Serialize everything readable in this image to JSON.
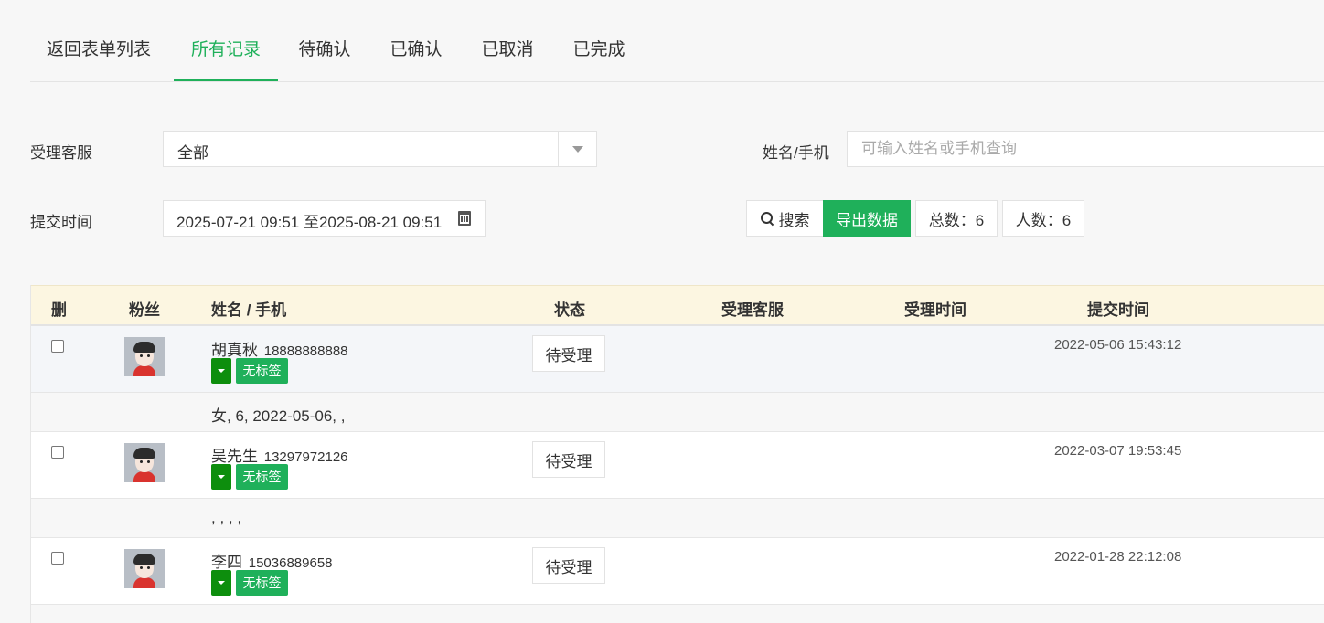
{
  "tabs": [
    "返回表单列表",
    "所有记录",
    "待确认",
    "已确认",
    "已取消",
    "已完成"
  ],
  "filters": {
    "staff_label": "受理客服",
    "staff_value": "全部",
    "name_label": "姓名/手机",
    "name_placeholder": "可输入姓名或手机查询",
    "time_label": "提交时间",
    "time_value": "2025-07-21 09:51 至2025-08-21 09:51"
  },
  "actions": {
    "search": "搜索",
    "export": "导出数据",
    "total": "总数：6",
    "people": "人数：6"
  },
  "table": {
    "headers": [
      "删",
      "粉丝",
      "姓名 / 手机",
      "状态",
      "受理客服",
      "受理时间",
      "提交时间"
    ],
    "rows": [
      {
        "name": "胡真秋",
        "phone": "18888888888",
        "tag": "无标签",
        "status": "待受理",
        "submit_time": "2022-05-06 15:43:12",
        "info": "女, 6, 2022-05-06, ,"
      },
      {
        "name": "吴先生",
        "phone": "13297972126",
        "tag": "无标签",
        "status": "待受理",
        "submit_time": "2022-03-07 19:53:45",
        "info": ", , , ,"
      },
      {
        "name": "李四",
        "phone": "15036889658",
        "tag": "无标签",
        "status": "待受理",
        "submit_time": "2022-01-28 22:12:08",
        "info": ""
      }
    ]
  },
  "colors": {
    "accent": "#1fb05a",
    "header_bg": "#fcf6e1",
    "tag_dropdown": "#0d8e0d"
  }
}
